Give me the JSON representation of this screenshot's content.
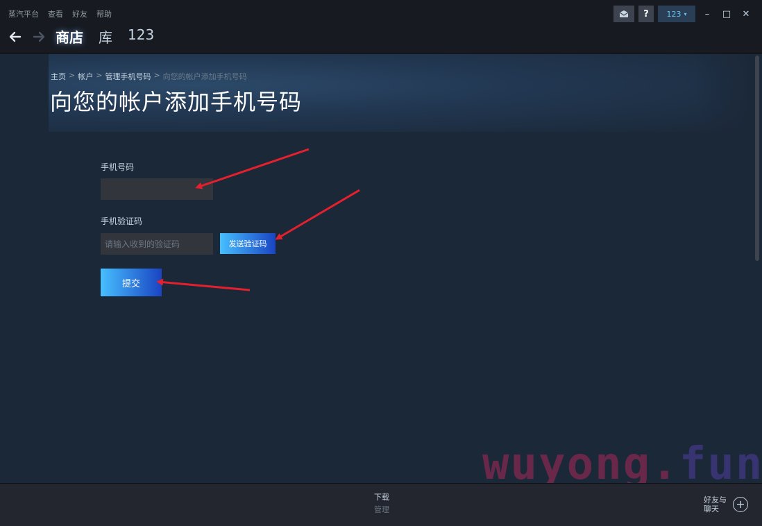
{
  "menu": [
    "蒸汽平台",
    "查看",
    "好友",
    "帮助"
  ],
  "nav": {
    "back_icon": "arrow-left-icon",
    "forward_icon": "arrow-right-icon"
  },
  "main_tabs": [
    "商店",
    "库",
    "123"
  ],
  "titlebar": {
    "user_label": "123",
    "help_label": "?",
    "mail_icon": "envelope-icon"
  },
  "window_controls": {
    "minimize": "–",
    "maximize": "□",
    "close": "✕"
  },
  "breadcrumb": {
    "home": "主页",
    "account": "帐户",
    "manage_phone": "管理手机号码",
    "current": "向您的帐户添加手机号码",
    "separator": ">"
  },
  "page_title": "向您的帐户添加手机号码",
  "form": {
    "phone_label": "手机号码",
    "phone_value": "",
    "code_label": "手机验证码",
    "code_placeholder": "请输入收到的验证码",
    "send_code_label": "发送验证码",
    "submit_label": "提交"
  },
  "watermark": {
    "text": "wuyong.",
    "text_tail": "fun"
  },
  "bottombar": {
    "downloads_label": "下载",
    "downloads_sub": "管理",
    "friends_label": "好友与聊天"
  },
  "colors": {
    "accent_gradient_start": "#47bfff",
    "accent_gradient_end": "#1a44c2",
    "annotation_arrow": "#e5202e",
    "background": "#1b2838"
  }
}
